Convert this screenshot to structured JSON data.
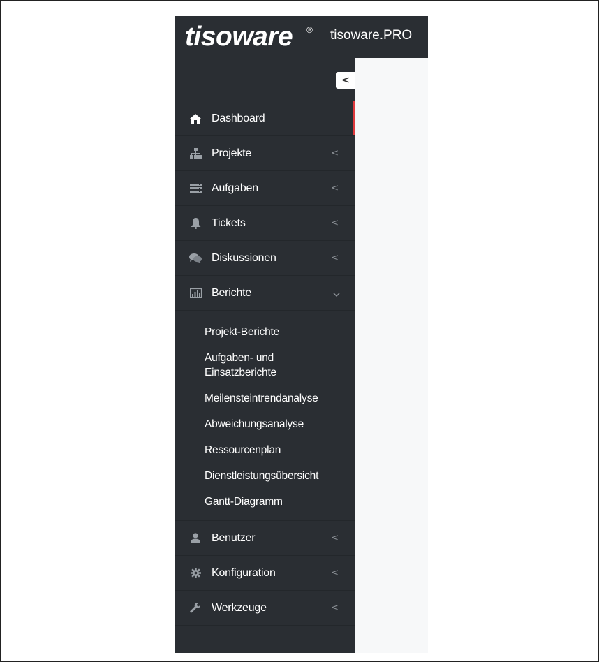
{
  "header": {
    "logo_text": "tisoware",
    "logo_registered": "®",
    "app_title": "tisoware.PRO"
  },
  "sidebar": {
    "collapse_glyph": "<",
    "accent_color": "#e03a3e",
    "background_color": "#2a2e33",
    "items": [
      {
        "label": "Dashboard",
        "icon": "home-icon",
        "has_chevron": false,
        "active": true
      },
      {
        "label": "Projekte",
        "icon": "sitemap-icon",
        "has_chevron": true
      },
      {
        "label": "Aufgaben",
        "icon": "server-icon",
        "has_chevron": true
      },
      {
        "label": "Tickets",
        "icon": "bell-icon",
        "has_chevron": true
      },
      {
        "label": "Diskussionen",
        "icon": "comments-icon",
        "has_chevron": true
      },
      {
        "label": "Berichte",
        "icon": "bar-chart-icon",
        "has_chevron": true,
        "expanded": true
      },
      {
        "label": "Benutzer",
        "icon": "user-icon",
        "has_chevron": true
      },
      {
        "label": "Konfiguration",
        "icon": "gear-icon",
        "has_chevron": true
      },
      {
        "label": "Werkzeuge",
        "icon": "wrench-icon",
        "has_chevron": true
      }
    ],
    "berichte_submenu": [
      "Projekt-Berichte",
      "Aufgaben- und Einsatzberichte",
      "Meilensteintrendanalyse",
      "Abweichungsanalyse",
      "Ressourcenplan",
      "Dienstleistungsübersicht",
      "Gantt-Diagramm"
    ],
    "chevron_left": "<"
  }
}
